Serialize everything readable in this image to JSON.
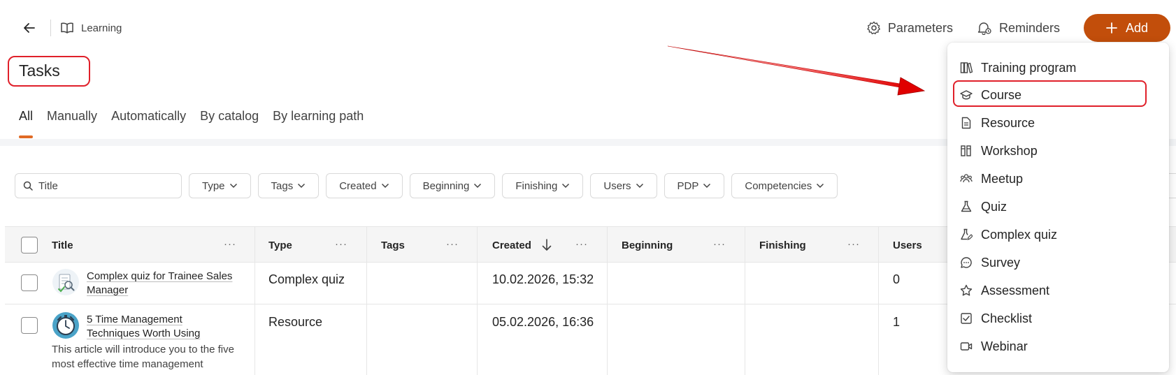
{
  "header": {
    "breadcrumb_label": "Learning",
    "parameters_label": "Parameters",
    "reminders_label": "Reminders",
    "add_label": "Add"
  },
  "page": {
    "title": "Tasks"
  },
  "tabs": [
    {
      "label": "All",
      "active": true
    },
    {
      "label": "Manually"
    },
    {
      "label": "Automatically"
    },
    {
      "label": "By catalog"
    },
    {
      "label": "By learning path"
    }
  ],
  "filters": {
    "search_placeholder": "Title",
    "chips": [
      "Type",
      "Tags",
      "Created",
      "Beginning",
      "Finishing",
      "Users",
      "PDP",
      "Competencies"
    ]
  },
  "table": {
    "columns": [
      "Title",
      "Type",
      "Tags",
      "Created",
      "Beginning",
      "Finishing",
      "Users"
    ],
    "rows": [
      {
        "title": "Complex quiz for Trainee Sales Manager",
        "title_line1": "Complex quiz for Trainee Sales",
        "title_line2": "Manager",
        "type": "Complex quiz",
        "tags": "",
        "created": "10.02.2026, 15:32",
        "beginning": "",
        "finishing": "",
        "users": "0"
      },
      {
        "title": "5 Time Management Techniques Worth Using",
        "title_line1": "5 Time Management",
        "title_line2": "Techniques Worth Using",
        "description_line1": "This article will introduce you to the five",
        "description_line2": "most effective time management",
        "type": "Resource",
        "tags": "",
        "created": "05.02.2026, 16:36",
        "beginning": "",
        "finishing": "",
        "users": "1"
      }
    ]
  },
  "add_menu": {
    "items": [
      {
        "label": "Training program",
        "icon": "books-icon"
      },
      {
        "label": "Course",
        "icon": "graduation-cap-icon",
        "highlighted": true
      },
      {
        "label": "Resource",
        "icon": "document-icon"
      },
      {
        "label": "Workshop",
        "icon": "workshop-icon"
      },
      {
        "label": "Meetup",
        "icon": "people-icon"
      },
      {
        "label": "Quiz",
        "icon": "flask-icon"
      },
      {
        "label": "Complex quiz",
        "icon": "flask-edit-icon"
      },
      {
        "label": "Survey",
        "icon": "chat-icon"
      },
      {
        "label": "Assessment",
        "icon": "star-icon"
      },
      {
        "label": "Checklist",
        "icon": "checkbox-icon"
      },
      {
        "label": "Webinar",
        "icon": "video-icon"
      }
    ]
  },
  "colors": {
    "accent": "#c24e0b",
    "highlight": "#e0202a",
    "tab_indicator": "#e06a25"
  }
}
